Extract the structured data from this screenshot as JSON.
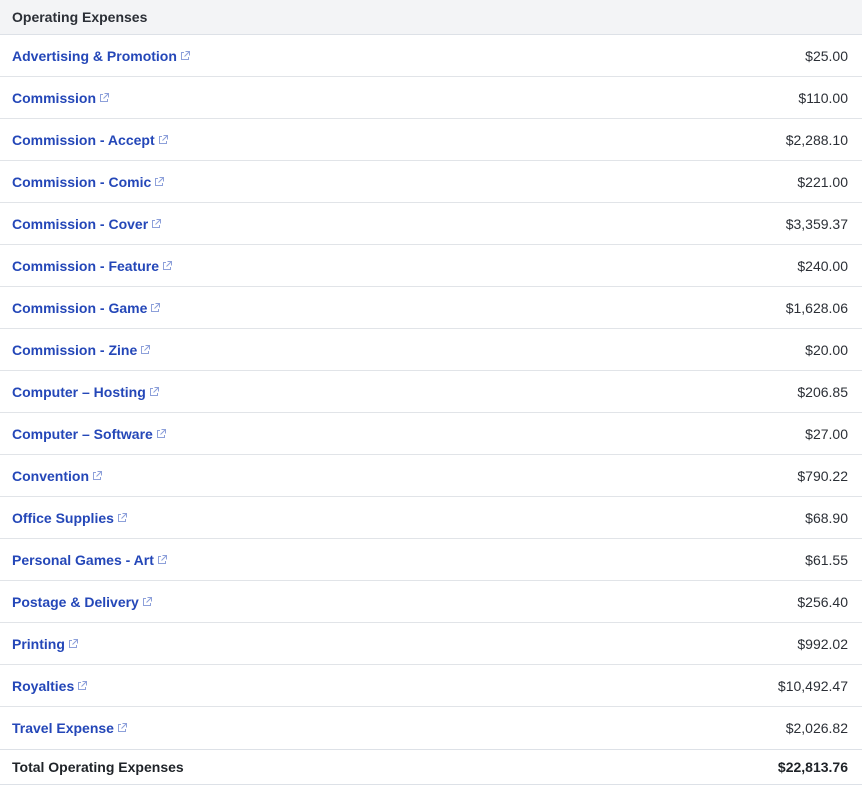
{
  "header": {
    "title": "Operating Expenses"
  },
  "rows": [
    {
      "label": "Advertising & Promotion",
      "amount": "$25.00"
    },
    {
      "label": "Commission",
      "amount": "$110.00"
    },
    {
      "label": "Commission - Accept",
      "amount": "$2,288.10"
    },
    {
      "label": "Commission - Comic",
      "amount": "$221.00"
    },
    {
      "label": "Commission - Cover",
      "amount": "$3,359.37"
    },
    {
      "label": "Commission - Feature",
      "amount": "$240.00"
    },
    {
      "label": "Commission - Game",
      "amount": "$1,628.06"
    },
    {
      "label": "Commission - Zine",
      "amount": "$20.00"
    },
    {
      "label": "Computer – Hosting",
      "amount": "$206.85"
    },
    {
      "label": "Computer – Software",
      "amount": "$27.00"
    },
    {
      "label": "Convention",
      "amount": "$790.22"
    },
    {
      "label": "Office Supplies",
      "amount": "$68.90"
    },
    {
      "label": "Personal Games - Art",
      "amount": "$61.55"
    },
    {
      "label": "Postage & Delivery",
      "amount": "$256.40"
    },
    {
      "label": "Printing",
      "amount": "$992.02"
    },
    {
      "label": "Royalties",
      "amount": "$10,492.47"
    },
    {
      "label": "Travel Expense",
      "amount": "$2,026.82"
    }
  ],
  "total": {
    "label": "Total Operating Expenses",
    "amount": "$22,813.76"
  },
  "icons": {
    "row_link": "external-link-icon"
  },
  "colors": {
    "link": "#2447b8",
    "header_bg": "#f3f4f6",
    "divider": "#e1e4e8"
  }
}
